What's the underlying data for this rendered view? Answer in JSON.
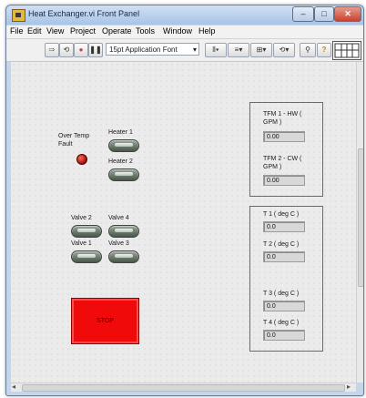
{
  "window": {
    "title": "Heat Exchanger.vi Front Panel",
    "controls": {
      "minimize": "–",
      "maximize": "□",
      "close": "✕"
    }
  },
  "menubar": {
    "items": [
      "File",
      "Edit",
      "View",
      "Project",
      "Operate",
      "Tools",
      "Window",
      "Help"
    ]
  },
  "toolbar": {
    "font_select": "15pt Application Font",
    "font_arrow": "▾",
    "buttons": {
      "run": "⇨",
      "run_continuous": "⟲",
      "abort": "●",
      "pause": "❚❚",
      "align": "⫴▾",
      "distribute": "≡▾",
      "resize": "⊞▾",
      "reorder": "⟲▾",
      "search": "⚲",
      "help": "?"
    }
  },
  "panel": {
    "over_temp_label": "Over Temp Fault",
    "heaters": [
      {
        "label": "Heater 1"
      },
      {
        "label": "Heater 2"
      }
    ],
    "valves": [
      {
        "label": "Valve 2"
      },
      {
        "label": "Valve 4"
      },
      {
        "label": "Valve 1"
      },
      {
        "label": "Valve 3"
      }
    ],
    "stop_label": "STOP",
    "flow": [
      {
        "label": "TFM 1 - HW ( GPM )",
        "value": "0.00"
      },
      {
        "label": "TFM 2 - CW ( GPM )",
        "value": "0.00"
      }
    ],
    "temps": [
      {
        "label": "T 1 ( deg C )",
        "value": "0.0"
      },
      {
        "label": "T 2 ( deg C )",
        "value": "0.0"
      },
      {
        "label": "T 3 ( deg C )",
        "value": "0.0"
      },
      {
        "label": "T 4 ( deg C )",
        "value": "0.0"
      }
    ]
  },
  "scrollbar": {
    "up": "▴",
    "down": "▾",
    "left": "◂",
    "right": "▸"
  }
}
